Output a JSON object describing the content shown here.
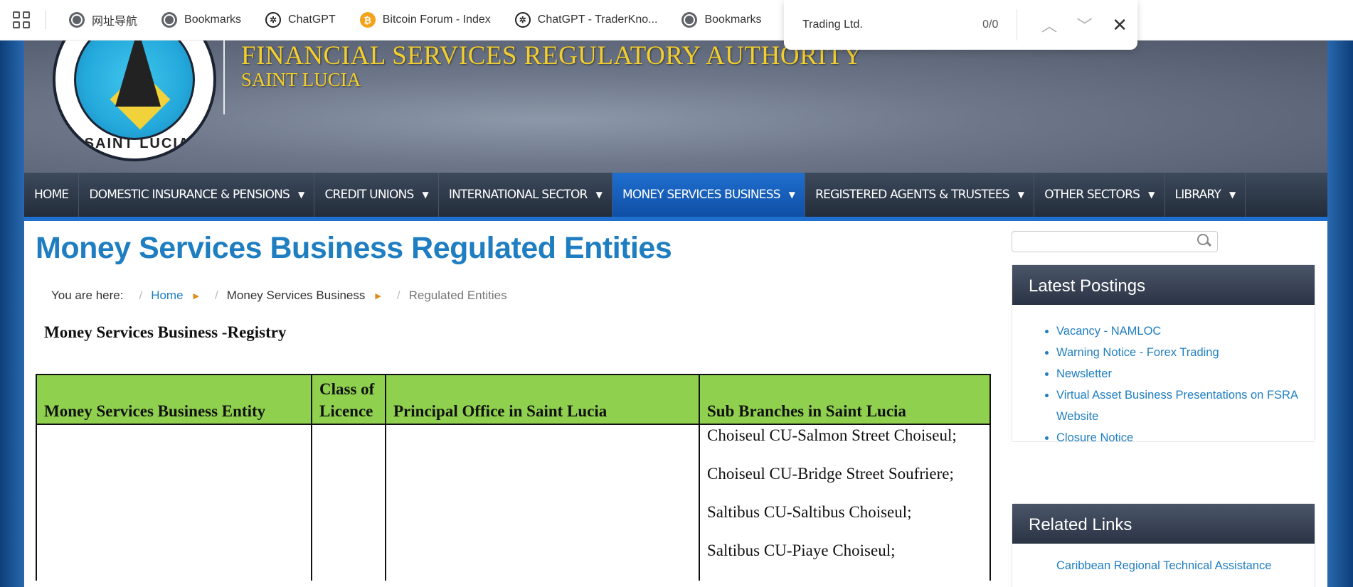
{
  "browser": {
    "bookmarks": [
      {
        "label": "网址导航",
        "icon": "globe-icon"
      },
      {
        "label": "Bookmarks",
        "icon": "globe-icon"
      },
      {
        "label": "ChatGPT",
        "icon": "chatgpt-icon"
      },
      {
        "label": "Bitcoin Forum - Index",
        "icon": "bitcoin-icon"
      },
      {
        "label": "ChatGPT - TraderKno...",
        "icon": "chatgpt-icon"
      },
      {
        "label": "Bookmarks",
        "icon": "globe-icon"
      }
    ],
    "find": {
      "query": "Trading Ltd.",
      "count": "0/0"
    }
  },
  "site": {
    "title": "FINANCIAL SERVICES  REGULATORY AUTHORITY",
    "subtitle": "SAINT LUCIA",
    "logo_text": "SAINT LUCIA"
  },
  "nav": [
    {
      "label": "HOME",
      "caret": false
    },
    {
      "label": "DOMESTIC INSURANCE & PENSIONS",
      "caret": true
    },
    {
      "label": "CREDIT UNIONS",
      "caret": true
    },
    {
      "label": "INTERNATIONAL SECTOR",
      "caret": true
    },
    {
      "label": "MONEY SERVICES BUSINESS",
      "caret": true,
      "active": true
    },
    {
      "label": "REGISTERED AGENTS & TRUSTEES",
      "caret": true
    },
    {
      "label": "OTHER SECTORS",
      "caret": true
    },
    {
      "label": "LIBRARY",
      "caret": true
    }
  ],
  "main": {
    "page_title": "Money Services Business Regulated Entities",
    "breadcrumb": {
      "prefix": "You are here:",
      "items": [
        "Home",
        "Money Services Business",
        "Regulated Entities"
      ]
    },
    "section_heading": "Money Services Business -Registry",
    "table": {
      "headers": [
        "Money Services Business Entity",
        "Class of Licence",
        "Principal Office in Saint Lucia",
        "Sub Branches in Saint Lucia"
      ],
      "rows": [
        {
          "entity": "",
          "class": "",
          "office": "",
          "branches": [
            "Choiseul CU-Salmon Street Choiseul;",
            "Choiseul CU-Bridge Street Soufriere;",
            "Saltibus CU-Saltibus Choiseul;",
            "Saltibus CU-Piaye Choiseul;"
          ]
        }
      ]
    }
  },
  "sidebar": {
    "latest_postings": {
      "title": "Latest Postings",
      "items": [
        "Vacancy - NAMLOC",
        "Warning Notice - Forex Trading",
        "Newsletter",
        "Virtual Asset Business Presentations on FSRA Website",
        "Closure Notice"
      ]
    },
    "related_links": {
      "title": "Related Links",
      "items": [
        "Caribbean Regional Technical Assistance"
      ]
    }
  },
  "colors": {
    "brand_blue": "#1f7ec1",
    "nav_active": "#1f6fcf",
    "table_header": "#8fd14f",
    "banner_gold": "#f2cf2e"
  }
}
